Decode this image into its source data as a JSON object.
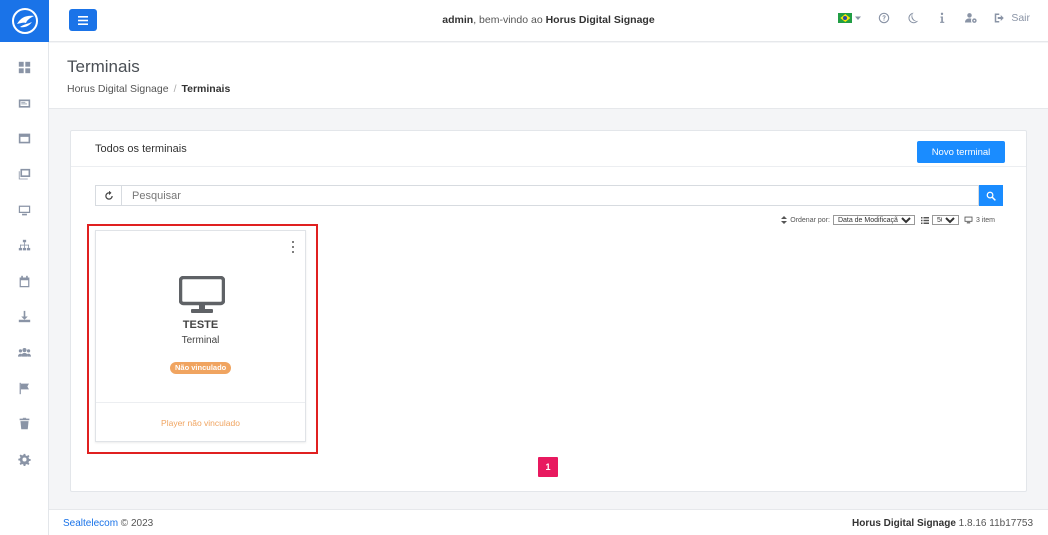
{
  "sidebar": {
    "items": [
      {
        "icon": "dashboard-icon"
      },
      {
        "icon": "media-icon"
      },
      {
        "icon": "layout-icon"
      },
      {
        "icon": "gallery-icon"
      },
      {
        "icon": "monitor-icon"
      },
      {
        "icon": "sitemap-icon"
      },
      {
        "icon": "calendar-icon"
      },
      {
        "icon": "download-icon"
      },
      {
        "icon": "users-icon"
      },
      {
        "icon": "flag-icon"
      },
      {
        "icon": "trash-icon"
      },
      {
        "icon": "gear-icon"
      }
    ]
  },
  "header": {
    "user": "admin",
    "welcome_text": ", bem-vindo ao ",
    "app_name": "Horus Digital Signage",
    "logout_label": "Sair"
  },
  "page": {
    "title": "Terminais",
    "breadcrumb": [
      "Horus Digital Signage",
      "/",
      "Terminais"
    ]
  },
  "card": {
    "title": "Todos os terminais",
    "new_button": "Novo terminal",
    "search_placeholder": "Pesquisar",
    "sort_label": "Ordenar por:",
    "sort_value": "Data de Modificação (",
    "per_page": "50",
    "item_count": "3 item"
  },
  "terminals": [
    {
      "name": "TESTE",
      "type": "Terminal",
      "status_badge": "Não vinculado",
      "footer": "Player não vinculado"
    }
  ],
  "pagination": {
    "current": "1"
  },
  "footer": {
    "company": "Sealtelecom",
    "copyright": " © 2023",
    "product": "Horus Digital Signage",
    "version": " 1.8.16 11b17753"
  },
  "colors": {
    "primary": "#1a73e8",
    "button": "#1a8cff",
    "warning": "#f0a460",
    "pager": "#e8195f",
    "highlight": "#e02020"
  }
}
